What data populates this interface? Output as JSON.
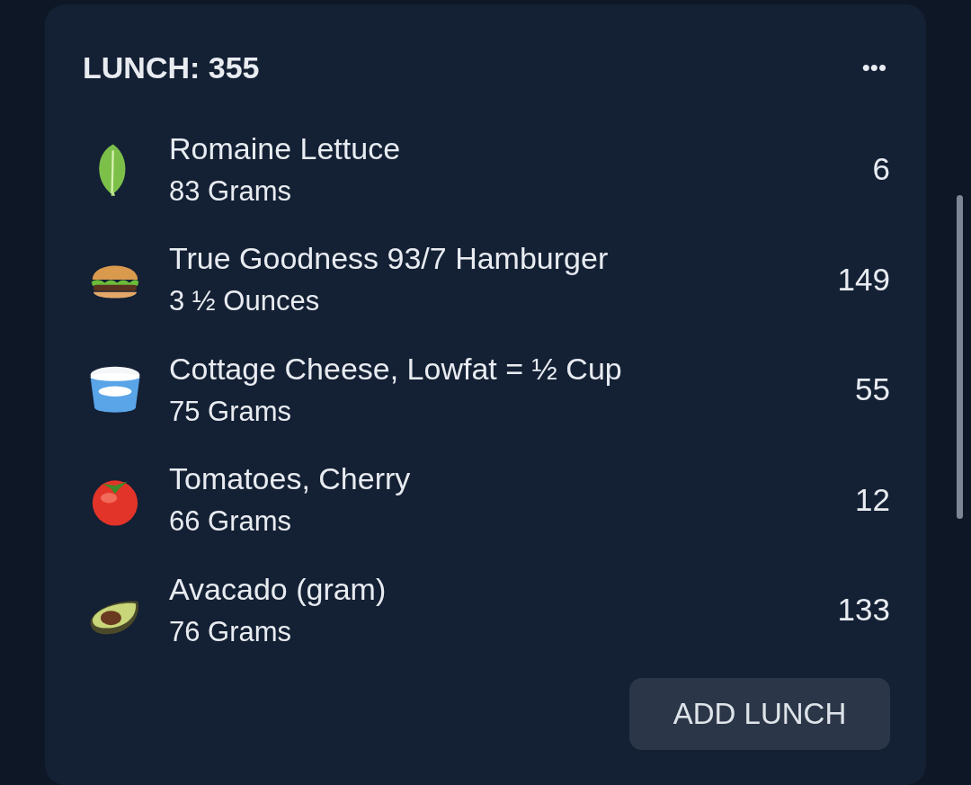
{
  "meal": {
    "title": "LUNCH: 355",
    "menu": "•••",
    "items": [
      {
        "kind": "lettuce",
        "name": "Romaine Lettuce",
        "amount": "83 Grams",
        "calories": "6"
      },
      {
        "kind": "burger",
        "name": "True Goodness 93/7 Hamburger",
        "amount": "3 ½ Ounces",
        "calories": "149"
      },
      {
        "kind": "cottage",
        "name": "Cottage Cheese, Lowfat = ½ Cup",
        "amount": "75 Grams",
        "calories": "55"
      },
      {
        "kind": "tomato",
        "name": "Tomatoes, Cherry",
        "amount": "66 Grams",
        "calories": "12"
      },
      {
        "kind": "avocado",
        "name": "Avacado (gram)",
        "amount": "76 Grams",
        "calories": "133"
      }
    ],
    "add_button": "ADD LUNCH"
  }
}
